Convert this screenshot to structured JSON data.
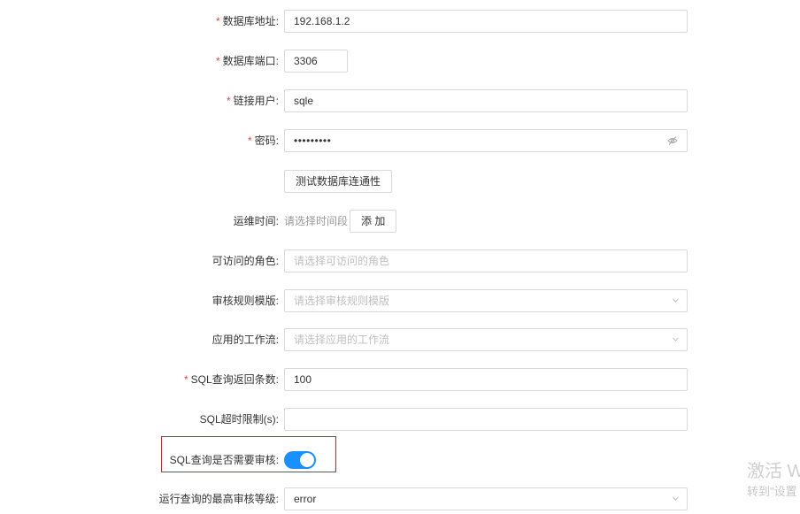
{
  "form": {
    "db_address": {
      "label": "数据库地址:",
      "required": true,
      "value": "192.168.1.2"
    },
    "db_port": {
      "label": "数据库端口:",
      "required": true,
      "value": "3306"
    },
    "db_user": {
      "label": "链接用户:",
      "required": true,
      "value": "sqle"
    },
    "db_password": {
      "label": "密码:",
      "required": true,
      "value": "•••••••••"
    },
    "test_connection_button": "测试数据库连通性",
    "maintenance_time": {
      "label": "运维时间:",
      "placeholder": "请选择时间段",
      "add_button": "添 加"
    },
    "roles": {
      "label": "可访问的角色:",
      "placeholder": "请选择可访问的角色"
    },
    "rule_template": {
      "label": "审核规则模版:",
      "placeholder": "请选择审核规则模版"
    },
    "workflow": {
      "label": "应用的工作流:",
      "placeholder": "请选择应用的工作流"
    },
    "sql_query_limit": {
      "label": "SQL查询返回条数:",
      "required": true,
      "value": "100"
    },
    "sql_timeout": {
      "label": "SQL超时限制(s):",
      "value": ""
    },
    "sql_query_audit": {
      "label": "SQL查询是否需要审核:",
      "enabled": true
    },
    "max_audit_level": {
      "label": "运行查询的最高审核等级:",
      "value": "error"
    }
  },
  "watermark": {
    "line1": "激活 W",
    "line2": "转到\"设置"
  },
  "colors": {
    "required_star": "#e8453c",
    "switch_on": "#1890ff",
    "highlight_border": "#e02020"
  }
}
